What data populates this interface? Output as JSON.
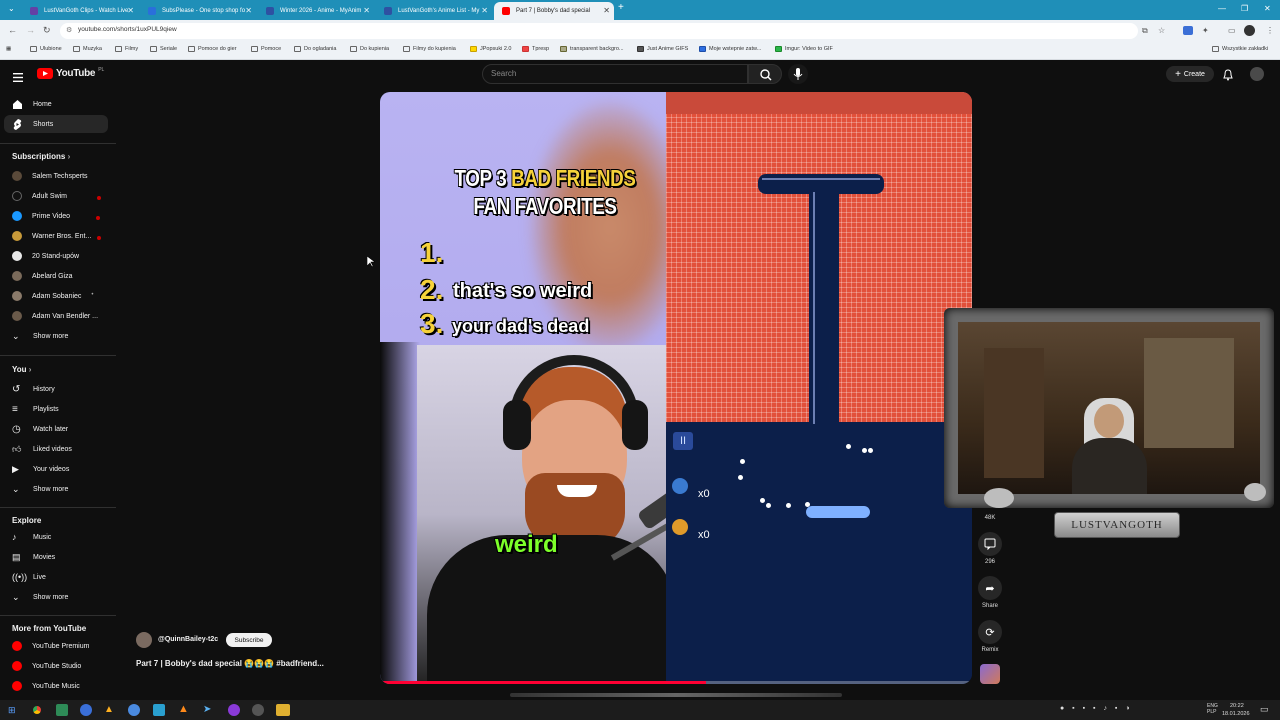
{
  "browser": {
    "tabs": [
      {
        "title": "LustVanGoth Clips - Watch Live",
        "color": "#6441a5"
      },
      {
        "title": "SubsPlease - One stop shop fo",
        "color": "#2a6fdb"
      },
      {
        "title": "Winter 2026 - Anime - MyAnim",
        "color": "#2e51a2"
      },
      {
        "title": "LustVanGoth's Anime List - My",
        "color": "#2e51a2"
      },
      {
        "title": "Part 7 | Bobby's dad special",
        "color": "#ff0000"
      }
    ],
    "url": "youtube.com/shorts/1uxPUL9qiew",
    "bookmarks": [
      "Ulubione",
      "Muzyka",
      "Filmy",
      "Seriale",
      "Pomoce do gier",
      "Pomoce",
      "Do ogladania",
      "Do kupienia",
      "Filmy do kupienia",
      "JPopsuki 2.0",
      "Tpresp",
      "transparent backgro...",
      "Just Anime GIFS",
      "Moje wstepnie zatw...",
      "Imgur: Video to GIF"
    ],
    "bookmarks_right": "Wszystkie zakładki"
  },
  "yt": {
    "logo": "YouTube",
    "region": "PL",
    "search_placeholder": "Search",
    "create_label": "Create",
    "nav": [
      {
        "label": "Home",
        "icon": "home-icon"
      },
      {
        "label": "Shorts",
        "icon": "shorts-icon"
      }
    ],
    "subscriptions_title": "Subscriptions",
    "subscriptions": [
      {
        "label": "Salem Techsperts",
        "color": "#5a4a3a"
      },
      {
        "label": "Adult Swim",
        "color": "#111"
      },
      {
        "label": "Prime Video",
        "color": "#1a98ff"
      },
      {
        "label": "Warner Bros. Ent...",
        "color": "#c89a3a"
      },
      {
        "label": "20 Stand-upów",
        "color": "#e9e9e9"
      },
      {
        "label": "Abelard Giza",
        "color": "#7a6a5a"
      },
      {
        "label": "Adam Sobaniec",
        "color": "#8a7a6a"
      },
      {
        "label": "Adam Van Bendler ...",
        "color": "#6a5a4a"
      }
    ],
    "show_more": "Show more",
    "you_title": "You",
    "you_items": [
      {
        "label": "History",
        "icon": "history-icon"
      },
      {
        "label": "Playlists",
        "icon": "playlists-icon"
      },
      {
        "label": "Watch later",
        "icon": "watch-later-icon"
      },
      {
        "label": "Liked videos",
        "icon": "like-icon"
      },
      {
        "label": "Your videos",
        "icon": "your-videos-icon"
      }
    ],
    "explore_title": "Explore",
    "explore_items": [
      {
        "label": "Music",
        "icon": "music-icon"
      },
      {
        "label": "Movies",
        "icon": "movies-icon"
      },
      {
        "label": "Live",
        "icon": "live-icon"
      }
    ],
    "more_title": "More from YouTube",
    "more_items": [
      {
        "label": "YouTube Premium"
      },
      {
        "label": "YouTube Studio"
      },
      {
        "label": "YouTube Music"
      }
    ]
  },
  "short": {
    "channel": "@QuinnBailey-t2c",
    "subscribe": "Subscribe",
    "title": "Part 7 | Bobby's dad special 😭😭😭 #badfriend...",
    "overlay_title_1_a": "TOP 3 ",
    "overlay_title_1_b": "BAD FRIENDS",
    "overlay_title_2": "FAN FAVORITES",
    "list": [
      {
        "num": "1.",
        "text": ""
      },
      {
        "num": "2.",
        "text": "that's so weird"
      },
      {
        "num": "3.",
        "text": "your dad's dead"
      }
    ],
    "caption": "weird",
    "game_score_1": "x0",
    "game_score_2": "x0",
    "likes": "48K",
    "comments": "296",
    "share": "Share",
    "remix": "Remix",
    "progress": 0.55
  },
  "stream": {
    "overlay_name": "LUSTVANGOTH"
  },
  "taskbar": {
    "lang": "ENG\nPLP",
    "time": "20:22",
    "date": "18.01.2026"
  }
}
